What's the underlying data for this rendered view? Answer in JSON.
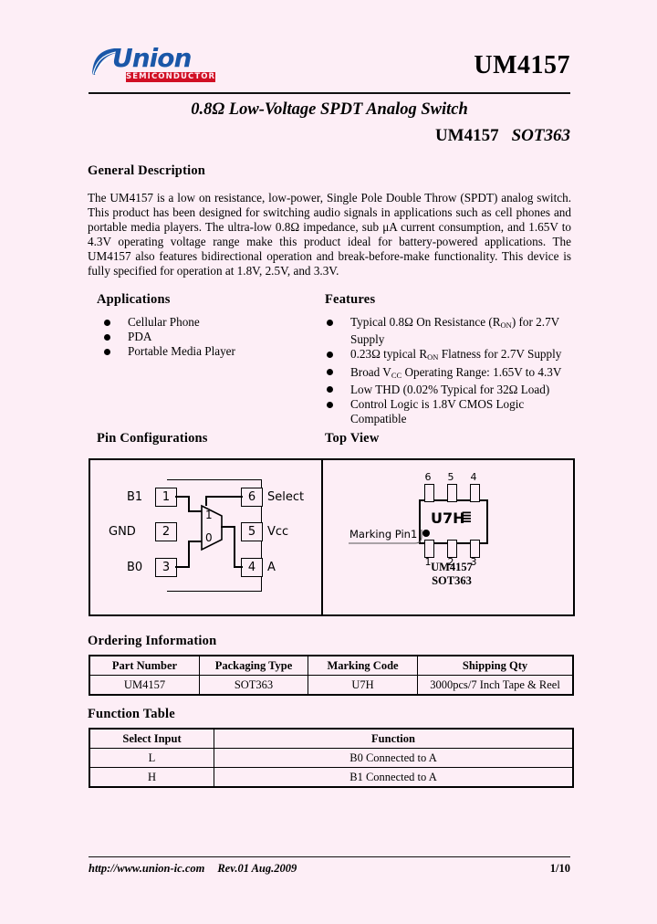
{
  "header": {
    "logo_word": "Union",
    "logo_sub": "SEMICONDUCTOR",
    "part_number": "UM4157",
    "subtitle": "0.8Ω Low-Voltage SPDT Analog Switch",
    "subtitle2_part": "UM4157",
    "subtitle2_package": "SOT363"
  },
  "general_description": {
    "heading": "General Description",
    "body": "The UM4157 is a low on resistance, low-power, Single Pole Double Throw (SPDT) analog switch. This product has been designed for switching audio signals in applications such as cell phones and portable media players. The ultra-low 0.8Ω impedance, sub μA current consumption, and 1.65V to 4.3V operating voltage range make this product ideal for battery-powered applications. The UM4157 also features bidirectional operation and break-before-make functionality. This device is fully specified for operation at 1.8V, 2.5V, and 3.3V."
  },
  "applications": {
    "heading": "Applications",
    "items": [
      "Cellular Phone",
      "PDA",
      "Portable Media Player"
    ]
  },
  "features": {
    "heading": "Features",
    "items": [
      "Typical 0.8Ω On Resistance (RON) for 2.7V Supply",
      "0.23Ω typical RON Flatness for 2.7V Supply",
      "Broad VCC Operating Range: 1.65V to 4.3V",
      "Low THD (0.02% Typical for 32Ω Load)",
      "Control Logic is 1.8V CMOS Logic Compatible"
    ]
  },
  "pin_configurations": {
    "heading": "Pin Configurations",
    "left_pins": [
      {
        "num": "1",
        "label": "B1"
      },
      {
        "num": "2",
        "label": "GND"
      },
      {
        "num": "3",
        "label": "B0"
      }
    ],
    "right_pins": [
      {
        "num": "6",
        "label": "Select"
      },
      {
        "num": "5",
        "label": "Vcc"
      },
      {
        "num": "4",
        "label": "A"
      }
    ],
    "mux_top_label": "1",
    "mux_bottom_label": "0"
  },
  "top_view": {
    "heading": "Top View",
    "marking_code": "U7H",
    "marking_symbol": "≣",
    "marking_pin_label": "Marking Pin1",
    "top_pin_numbers": [
      "6",
      "5",
      "4"
    ],
    "bottom_pin_numbers": [
      "1",
      "2",
      "3"
    ],
    "part_name": "UM4157",
    "package_name": "SOT363"
  },
  "ordering_information": {
    "heading": "Ordering Information",
    "columns": [
      "Part Number",
      "Packaging Type",
      "Marking Code",
      "Shipping Qty"
    ],
    "rows": [
      [
        "UM4157",
        "SOT363",
        "U7H",
        "3000pcs/7 Inch Tape & Reel"
      ]
    ]
  },
  "function_table": {
    "heading": "Function Table",
    "columns": [
      "Select Input",
      "Function"
    ],
    "rows": [
      [
        "L",
        "B0 Connected to A"
      ],
      [
        "H",
        "B1 Connected to A"
      ]
    ]
  },
  "footer": {
    "url": "http://www.union-ic.com",
    "revision": "Rev.01 Aug.2009",
    "page_number": "1/10"
  },
  "colors": {
    "page_background": "#fdeef6",
    "logo_blue": "#1a57a8",
    "logo_red": "#d10f24",
    "text": "#000000"
  }
}
